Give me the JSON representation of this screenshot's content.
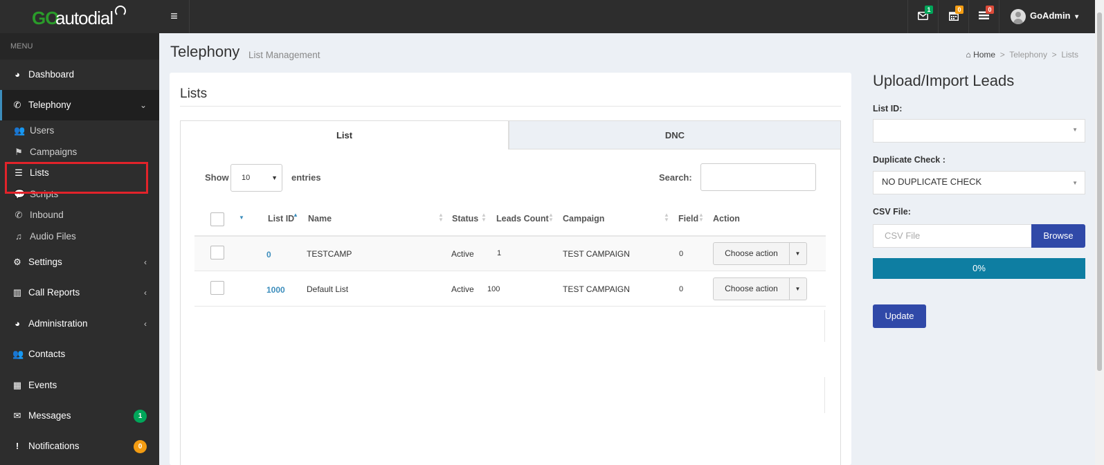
{
  "brand": {
    "go": "GO",
    "rest": "autodial"
  },
  "topbar": {
    "messages_count": "1",
    "calendar_count": "0",
    "tasks_count": "0",
    "user_name": "GoAdmin",
    "user_caret": "▾",
    "menu_toggle": "≡"
  },
  "sidebar": {
    "header": "MENU",
    "dashboard": "Dashboard",
    "telephony": "Telephony",
    "sub": {
      "users": "Users",
      "campaigns": "Campaigns",
      "lists": "Lists",
      "scripts": "Scripts",
      "inbound": "Inbound",
      "audio": "Audio Files"
    },
    "settings": "Settings",
    "call_reports": "Call Reports",
    "administration": "Administration",
    "contacts": "Contacts",
    "events": "Events",
    "messages": "Messages",
    "messages_badge": "1",
    "notifications": "Notifications",
    "notifications_badge": "0"
  },
  "header": {
    "title": "Telephony",
    "subtitle": "List Management",
    "breadcrumb": {
      "home": "Home",
      "sep": ">",
      "telephony": "Telephony",
      "lists": "Lists"
    }
  },
  "main": {
    "box_title": "Lists",
    "tabs": {
      "list": "List",
      "dnc": "DNC"
    },
    "show_label": "Show",
    "page_length": "10",
    "entries_label": "entries",
    "search_label": "Search:",
    "columns": {
      "list_id": "List ID",
      "name": "Name",
      "status": "Status",
      "leads_count": "Leads Count",
      "campaign": "Campaign",
      "field": "Field",
      "action": "Action"
    },
    "rows": [
      {
        "list_id": "0",
        "name": "TESTCAMP",
        "status": "Active",
        "leads_count": "1",
        "campaign": "TEST CAMPAIGN",
        "field": "0",
        "action": "Choose action"
      },
      {
        "list_id": "1000",
        "name": "Default List",
        "status": "Active",
        "leads_count": "100",
        "campaign": "TEST CAMPAIGN",
        "field": "0",
        "action": "Choose action"
      }
    ]
  },
  "upload": {
    "title": "Upload/Import Leads",
    "list_id_label": "List ID:",
    "list_id_value": "",
    "duplicate_label": "Duplicate Check :",
    "duplicate_value": "NO DUPLICATE CHECK",
    "csv_label": "CSV File:",
    "csv_placeholder": "CSV File",
    "browse": "Browse",
    "progress_text": "0%",
    "progress_value": 0,
    "update": "Update"
  },
  "colors": {
    "accent_blue": "#3049a8",
    "progress": "#0e7ea2",
    "highlight_red": "#e2232a",
    "badge_green": "#00a65a",
    "badge_orange": "#f39c12",
    "badge_red": "#dd4b39"
  }
}
